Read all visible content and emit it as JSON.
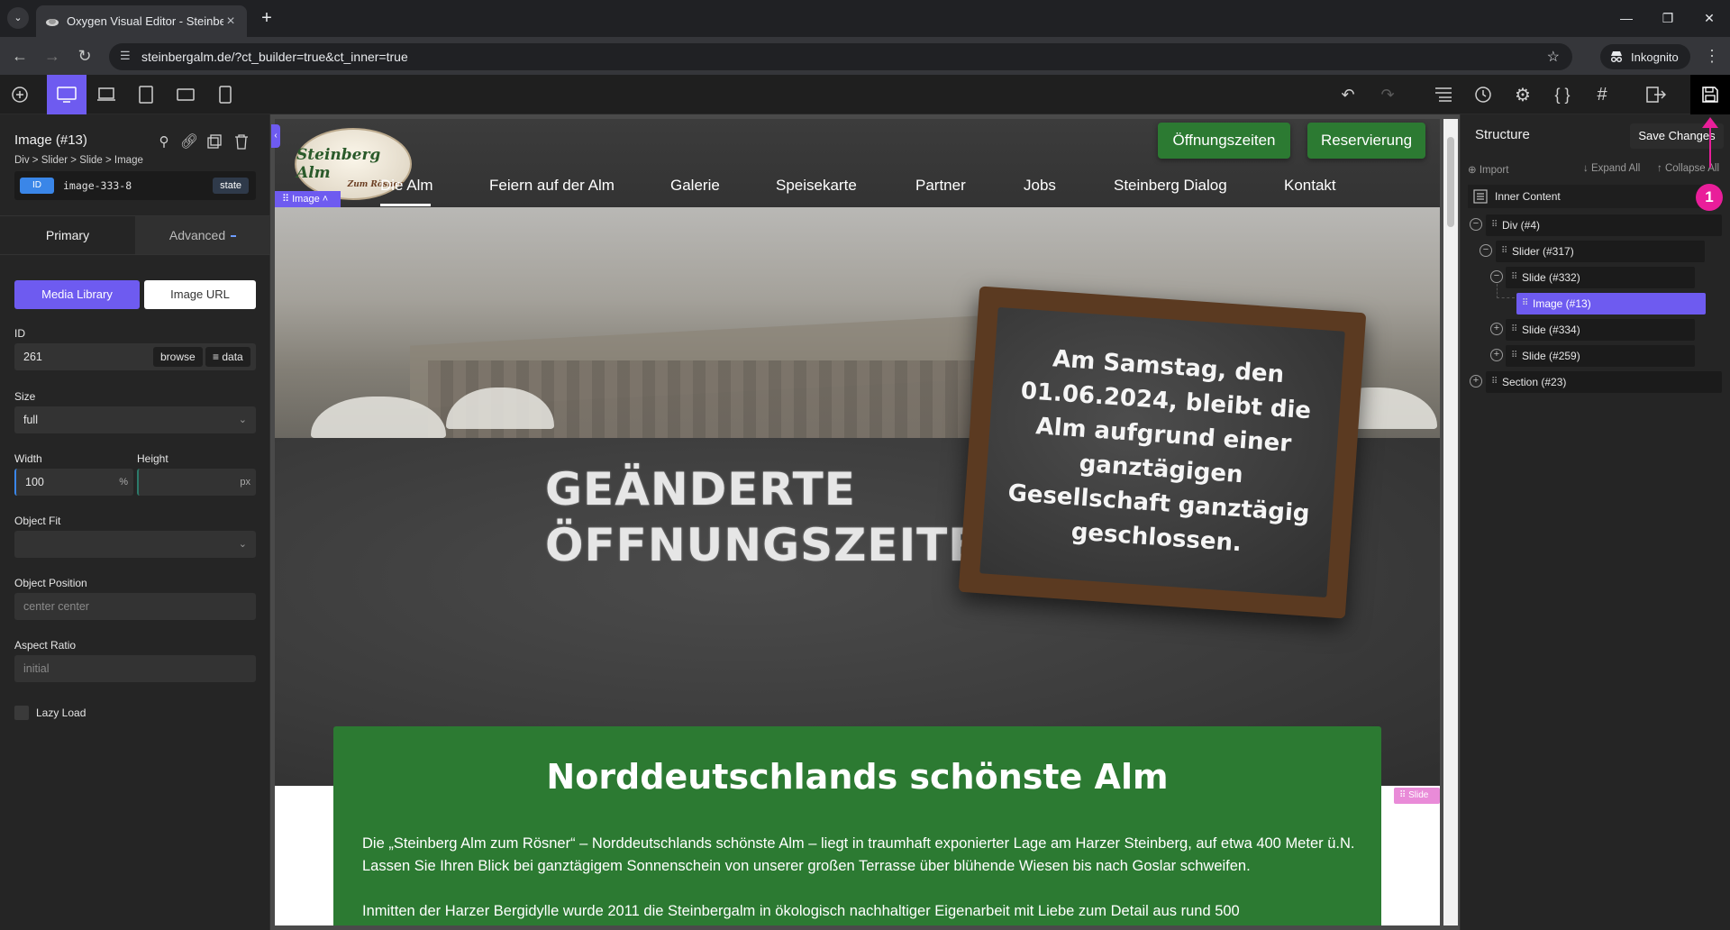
{
  "browser": {
    "tab_title": "Oxygen Visual Editor - Steinber",
    "url": "steinbergalm.de/?ct_builder=true&ct_inner=true",
    "incognito_label": "Inkognito"
  },
  "left_panel": {
    "title": "Image (#13)",
    "breadcrumb": "Div > Slider > Slide > Image",
    "selector_tag": "ID",
    "selector_name": "image-333-8",
    "state_label": "state",
    "tabs": {
      "primary": "Primary",
      "advanced": "Advanced"
    },
    "media_library_label": "Media Library",
    "image_url_label": "Image URL",
    "id_label": "ID",
    "id_value": "261",
    "browse_label": "browse",
    "data_label": "data",
    "size_label": "Size",
    "size_value": "full",
    "width_label": "Width",
    "width_value": "100",
    "width_unit": "%",
    "height_label": "Height",
    "height_value": "",
    "height_unit": "px",
    "object_fit_label": "Object Fit",
    "object_fit_value": "",
    "object_position_label": "Object Position",
    "object_position_placeholder": "center center",
    "aspect_ratio_label": "Aspect Ratio",
    "aspect_ratio_placeholder": "initial",
    "lazy_load_label": "Lazy Load"
  },
  "site": {
    "logo_text": "Steinberg Alm",
    "logo_sub": "Zum Rösner",
    "btn_hours": "Öffnungszeiten",
    "btn_reserve": "Reservierung",
    "nav": [
      "Die Alm",
      "Feiern auf der Alm",
      "Galerie",
      "Speisekarte",
      "Partner",
      "Jobs",
      "Steinberg Dialog",
      "Kontakt"
    ],
    "image_badge": "Image",
    "slate_line1": "GEÄNDERTE",
    "slate_line2": "ÖFFNUNGSZEITEN",
    "chalk_text": "Am Samstag, den 01.06.2024, bleibt die Alm aufgrund einer ganztägigen Gesellschaft ganztägig geschlossen.",
    "section_title": "Norddeutschlands schönste Alm",
    "para1": "Die „Steinberg Alm zum Rösner“ – Norddeutschlands schönste Alm – liegt in traumhaft exponierter Lage am Harzer Steinberg, auf etwa 400 Meter ü.N. Lassen Sie Ihren Blick bei ganztägigem Sonnenschein von unserer großen Terrasse über blühende Wiesen bis nach Goslar schweifen.",
    "para2": "Inmitten der Harzer Bergidylle wurde 2011 die Steinbergalm in ökologisch nachhaltiger Eigenarbeit mit Liebe zum Detail aus rund 500",
    "slide_badge": "Slide"
  },
  "structure": {
    "title": "Structure",
    "save_label": "Save Changes",
    "import_label": "Import",
    "expand_label": "Expand All",
    "collapse_label": "Collapse All",
    "inner_content": "Inner Content",
    "nodes": [
      "Div (#4)",
      "Slider (#317)",
      "Slide (#332)",
      "Image (#13)",
      "Slide (#334)",
      "Slide (#259)",
      "Section (#23)"
    ]
  },
  "annotation": {
    "marker": "1"
  },
  "colors": {
    "accent": "#6e5bf0",
    "green": "#2c7a32",
    "marker": "#e91e9a"
  }
}
